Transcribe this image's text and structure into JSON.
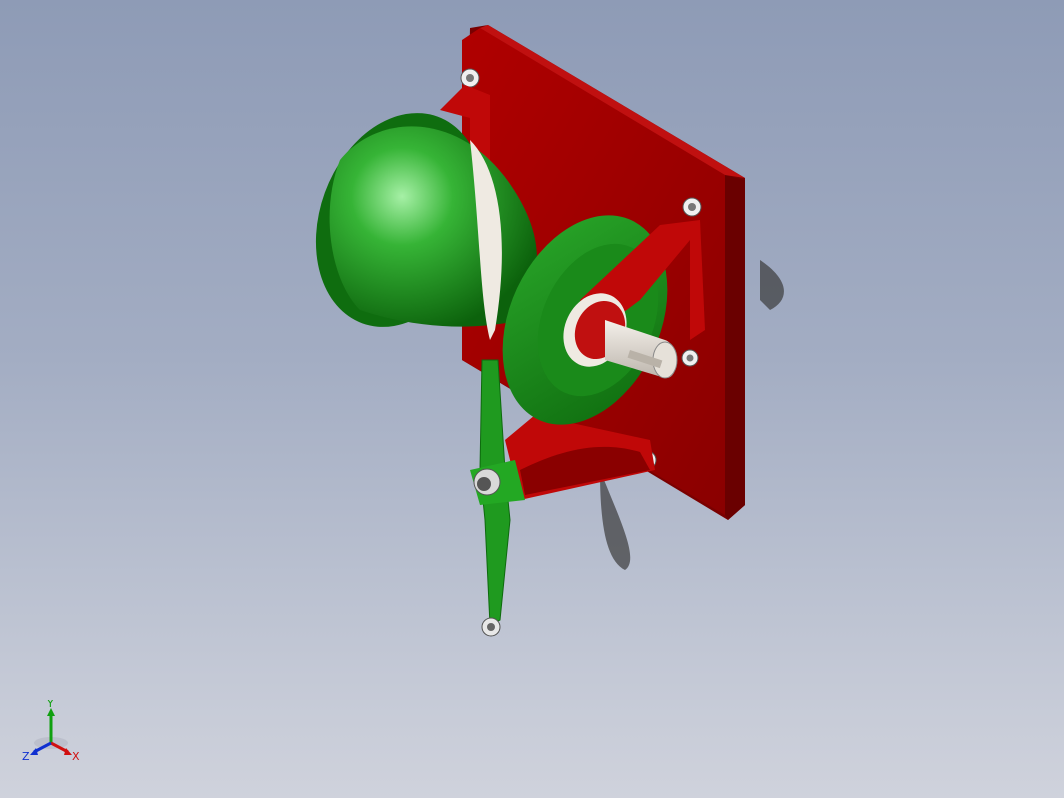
{
  "viewport": {
    "background_top": "#8e9bb6",
    "background_bottom": "#cfd2dc"
  },
  "model": {
    "colors": {
      "plate": "#b00000",
      "plate_dark": "#7a0000",
      "drum": "#1f9a1f",
      "drum_dark": "#0f6d0f",
      "drum_light": "#8fe08f",
      "shaft": "#e8e3dc",
      "bolt": "#d9d9d9"
    }
  },
  "triad": {
    "x_label": "X",
    "y_label": "Y",
    "z_label": "Z",
    "x_color": "#d01010",
    "y_color": "#10a010",
    "z_color": "#1030d0"
  }
}
